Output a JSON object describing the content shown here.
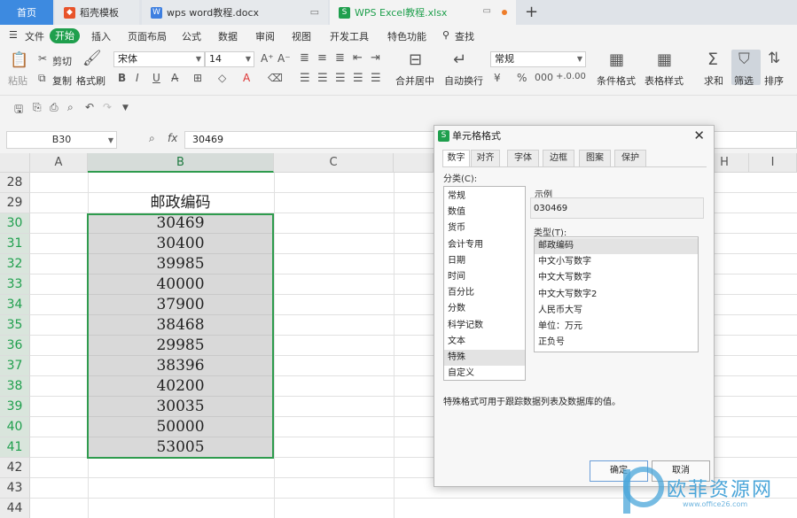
{
  "tabs": {
    "home": "首页",
    "doc": "稻壳模板",
    "word": "wps word教程.docx",
    "excel": "WPS Excel教程.xlsx"
  },
  "menu": {
    "file": "文件",
    "start": "开始",
    "items": [
      "插入",
      "页面布局",
      "公式",
      "数据",
      "审阅",
      "视图",
      "开发工具",
      "特色功能"
    ],
    "search": "查找"
  },
  "ribbon": {
    "paste": "粘贴",
    "cut": "剪切",
    "copy": "复制",
    "format_painter": "格式刷",
    "font": "宋体",
    "size": "14",
    "merge": "合并居中",
    "wrap": "自动换行",
    "numfmt": "常规",
    "cond_fmt": "条件格式",
    "table_style": "表格样式",
    "sum": "求和",
    "filter": "筛选",
    "sort": "排序"
  },
  "formula": {
    "namebox": "B30",
    "fx": "fx",
    "value": "30469"
  },
  "grid": {
    "columns": [
      "A",
      "B",
      "C",
      "H",
      "I"
    ],
    "rows": [
      "28",
      "29",
      "30",
      "31",
      "32",
      "33",
      "34",
      "35",
      "36",
      "37",
      "38",
      "39",
      "40",
      "41",
      "42",
      "43",
      "44"
    ],
    "header_cell": "邮政编码",
    "values": [
      "30469",
      "30400",
      "39985",
      "40000",
      "37900",
      "38468",
      "29985",
      "38396",
      "40200",
      "30035",
      "50000",
      "53005"
    ]
  },
  "dialog": {
    "title": "单元格格式",
    "tabs": [
      "数字",
      "对齐",
      "字体",
      "边框",
      "图案",
      "保护"
    ],
    "category_label": "分类(C):",
    "categories": [
      "常规",
      "数值",
      "货币",
      "会计专用",
      "日期",
      "时间",
      "百分比",
      "分数",
      "科学记数",
      "文本",
      "特殊",
      "自定义"
    ],
    "sample_label": "示例",
    "sample_value": "030469",
    "type_label": "类型(T):",
    "types": [
      "邮政编码",
      "中文小写数字",
      "中文大写数字",
      "中文大写数字2",
      "人民币大写",
      "单位：万元",
      "正负号"
    ],
    "description": "特殊格式可用于跟踪数据列表及数据库的值。",
    "ok": "确定",
    "cancel": "取消"
  },
  "watermark": {
    "text": "欧菲资源网",
    "url": "www.office26.com"
  },
  "colors": {
    "accent": "#1f9f4d",
    "tab_home": "#3d8ae0",
    "selection": "#2e9b4d"
  }
}
